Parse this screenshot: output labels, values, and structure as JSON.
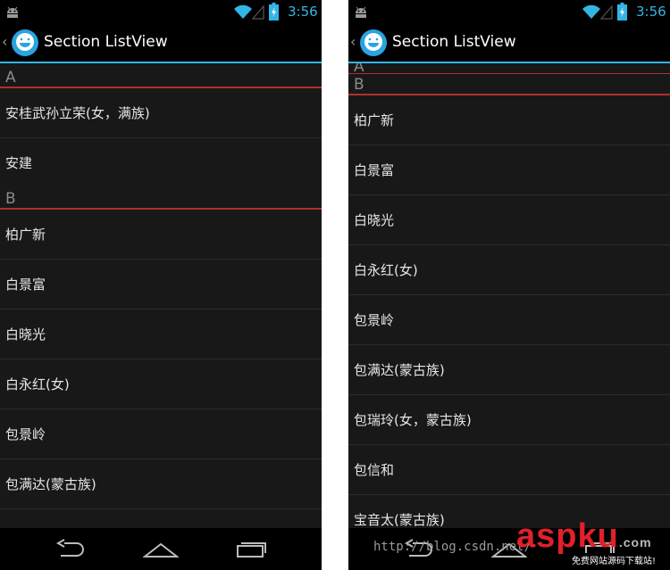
{
  "status_bar": {
    "time": "3:56"
  },
  "action_bar": {
    "title": "Section ListView"
  },
  "left_screen": {
    "sections": [
      {
        "letter": "A",
        "items": [
          "安桂武孙立荣(女，满族)",
          "安建"
        ]
      },
      {
        "letter": "B",
        "items": [
          "柏广新",
          "白景富",
          "白晓光",
          "白永红(女)",
          "包景岭",
          "包满达(蒙古族)",
          ""
        ]
      }
    ]
  },
  "right_screen": {
    "sections": [
      {
        "letter": "A",
        "items": []
      },
      {
        "letter": "B",
        "items": [
          "柏广新",
          "白景富",
          "白晓光",
          "白永红(女)",
          "包景岭",
          "包满达(蒙古族)",
          "包瑞玲(女，蒙古族)",
          "包信和",
          "宝音太(蒙古族)"
        ]
      }
    ]
  },
  "watermark": {
    "url": "http://blog.csdn.net/",
    "logo_text_1": "asp",
    "logo_text_2": "ku",
    "logo_suffix": ".com",
    "logo_tagline": "免费网站源码下载站!"
  },
  "colors": {
    "accent": "#33b5e5",
    "section_divider": "#b22e2e",
    "logo_red": "#e1202a"
  }
}
